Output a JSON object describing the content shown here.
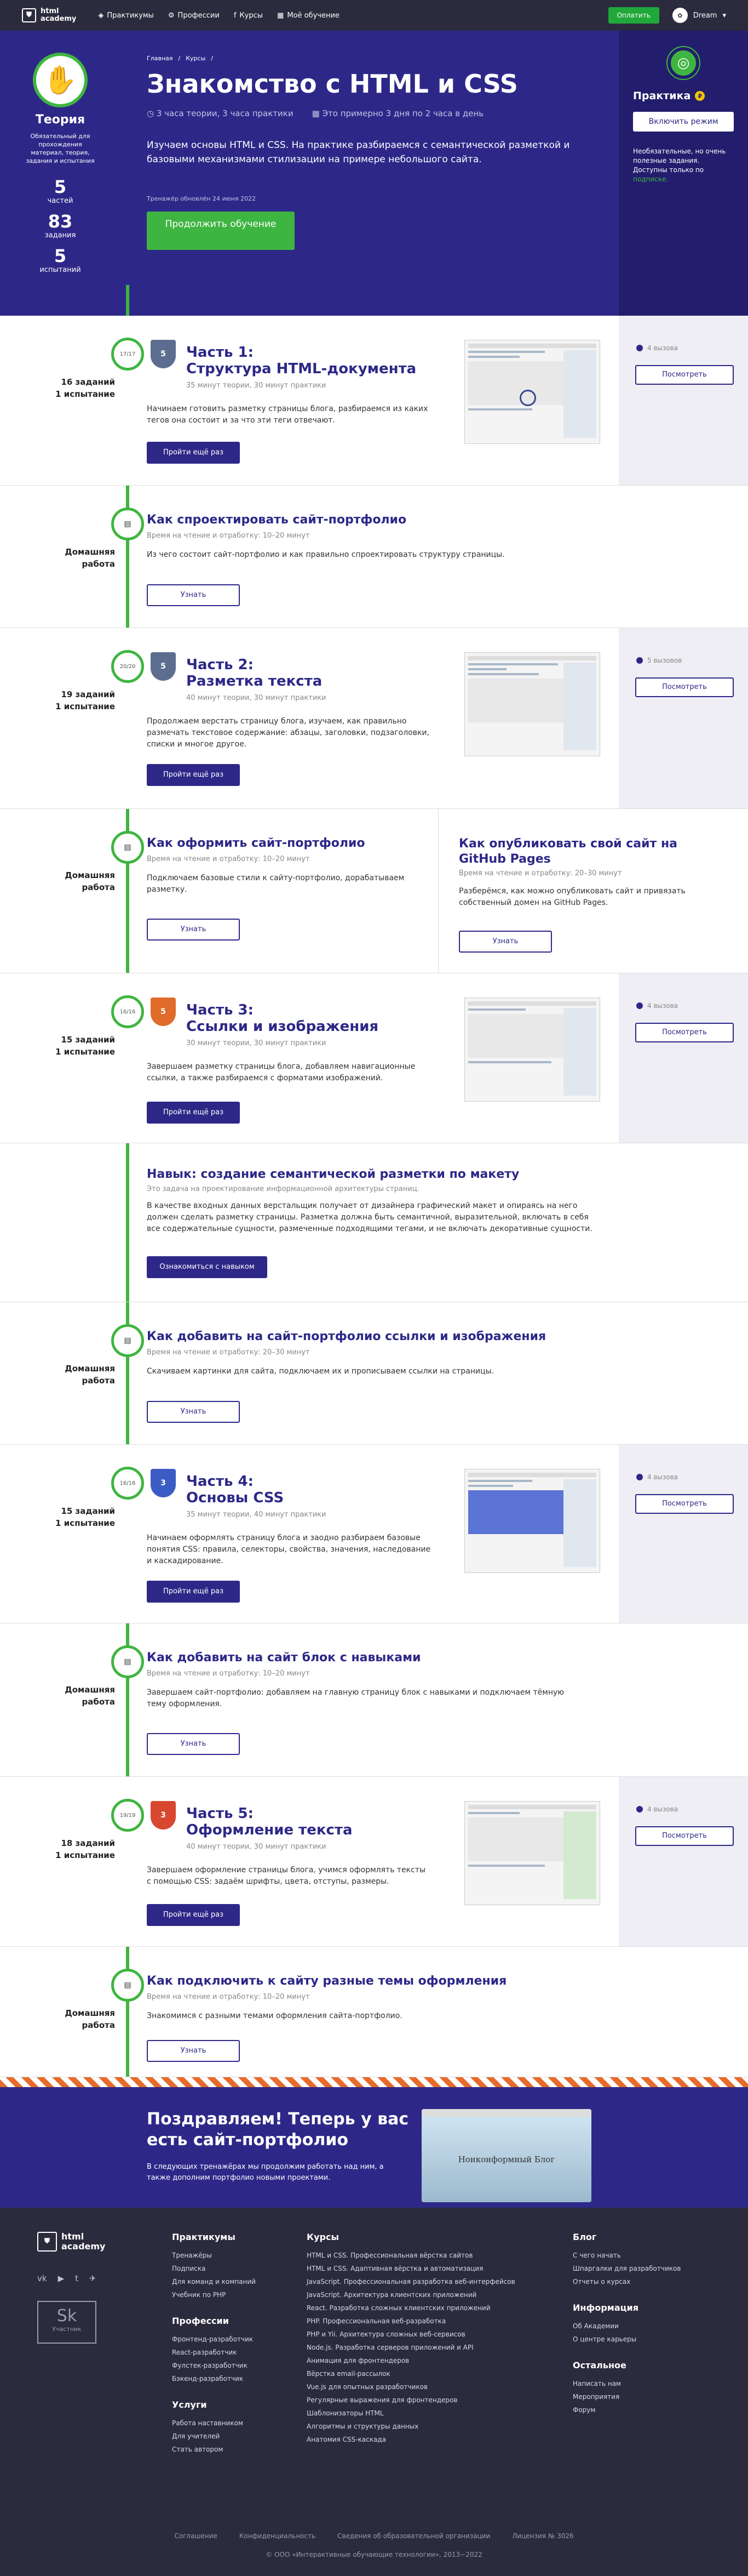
{
  "header": {
    "logo_line1": "html",
    "logo_line2": "academy",
    "nav": [
      {
        "icon": "◈",
        "label": "Практикумы"
      },
      {
        "icon": "⚙",
        "label": "Профессии"
      },
      {
        "icon": "f",
        "label": "Курсы"
      },
      {
        "icon": "▦",
        "label": "Моё обучение"
      }
    ],
    "pay": "Оплатить",
    "user": "Dream"
  },
  "hero": {
    "breadcrumb": [
      "Главная",
      "Курсы"
    ],
    "title": "Знакомство с HTML и CSS",
    "meta1": "3 часа теории, 3 часа практики",
    "meta2": "Это примерно 3 дня по 2 часа в день",
    "desc": "Изучаем основы HTML и CSS. На практике разбираемся с семантической разметкой и базовыми механизмами стилизации на примере небольшого сайта.",
    "updated": "Тренажёр обновлён 24 июня 2022",
    "cta": "Продолжить обучение"
  },
  "theory": {
    "title": "Теория",
    "desc": "Обязательный для прохождения материал, теория, задания и испытания",
    "parts_num": "5",
    "parts_lbl": "частей",
    "tasks_num": "83",
    "tasks_lbl": "задания",
    "tests_num": "5",
    "tests_lbl": "испытаний"
  },
  "practice": {
    "title": "Практика",
    "btn": "Включить режим",
    "note": "Необязательные, но очень полезные задания. Доступны только по",
    "link": "подписке."
  },
  "parts": [
    {
      "title": "Часть 1:",
      "subtitle": "Структура HTML-документа",
      "meta": "35 минут теории, 30 минут практики",
      "desc": "Начинаем готовить разметку страницы блога, разбираемся из каких тегов она состоит и за что эти теги отвечают.",
      "btn": "Пройти ещё раз",
      "calls": "4 вызова",
      "side_btn": "Посмотреть",
      "node": "17/17",
      "cap1": "16 заданий",
      "cap2": "1 испытание"
    },
    {
      "title": "Часть 2:",
      "subtitle": "Разметка текста",
      "meta": "40 минут теории, 30 минут практики",
      "desc": "Продолжаем верстать страницу блога, изучаем, как правильно размечать текстовое содержание: абзацы, заголовки, подзаголовки, списки и многое другое.",
      "btn": "Пройти ещё раз",
      "calls": "5 вызовов",
      "side_btn": "Посмотреть",
      "node": "20/20",
      "cap1": "19 заданий",
      "cap2": "1 испытание"
    },
    {
      "title": "Часть 3:",
      "subtitle": "Ссылки и изображения",
      "meta": "30 минут теории, 30 минут практики",
      "desc": "Завершаем разметку страницы блога, добавляем навигационные ссылки, а также разбираемся с форматами изображений.",
      "btn": "Пройти ещё раз",
      "calls": "4 вызова",
      "side_btn": "Посмотреть",
      "node": "16/16",
      "cap1": "15 заданий",
      "cap2": "1 испытание"
    },
    {
      "title": "Часть 4:",
      "subtitle": "Основы CSS",
      "meta": "35 минут теории, 40 минут практики",
      "desc": "Начинаем оформлять страницу блога и заодно разбираем базовые понятия CSS: правила, селекторы, свойства, значения, наследование и каскадирование.",
      "btn": "Пройти ещё раз",
      "calls": "4 вызова",
      "side_btn": "Посмотреть",
      "node": "16/16",
      "cap1": "15 заданий",
      "cap2": "1 испытание"
    },
    {
      "title": "Часть 5:",
      "subtitle": "Оформление текста",
      "meta": "40 минут теории, 30 минут практики",
      "desc": "Завершаем оформление страницы блога, учимся оформлять тексты с помощью CSS: задаём шрифты, цвета, отступы, размеры.",
      "btn": "Пройти ещё раз",
      "calls": "4 вызова",
      "side_btn": "Посмотреть",
      "node": "19/19",
      "cap1": "18 заданий",
      "cap2": "1 испытание"
    }
  ],
  "home": {
    "cap1": "Домашняя",
    "cap2": "работа",
    "node": "▤"
  },
  "homeworks": [
    {
      "title": "Как спроектировать сайт-портфолио",
      "meta": "Время на чтение и отработку: 10–20 минут",
      "desc": "Из чего состоит сайт-портфолио и как правильно спроектировать структуру страницы.",
      "btn": "Узнать"
    },
    {
      "title": "Как оформить сайт-портфолио",
      "meta": "Время на чтение и отработку: 10–20 минут",
      "desc": "Подключаем базовые стили к сайту-портфолио, дорабатываем разметку.",
      "btn": "Узнать",
      "title2": "Как опубликовать свой сайт на GitHub Pages",
      "meta2": "Время на чтение и отработку: 20–30 минут",
      "desc2": "Разберёмся, как можно опубликовать сайт и привязать собственный домен на GitHub Pages.",
      "btn2": "Узнать"
    },
    {
      "title": "Как добавить на сайт-портфолио ссылки и изображения",
      "meta": "Время на чтение и отработку: 20–30 минут",
      "desc": "Скачиваем картинки для сайта, подключаем их и прописываем ссылки на страницы.",
      "btn": "Узнать"
    },
    {
      "title": "Как добавить на сайт блок с навыками",
      "meta": "Время на чтение и отработку: 10–20 минут",
      "desc": "Завершаем сайт-портфолио: добавляем на главную страницу блок с навыками и подключаем тёмную тему оформления.",
      "btn": "Узнать"
    },
    {
      "title": "Как подключить к сайту разные темы оформления",
      "meta": "Время на чтение и отработку: 10–20 минут",
      "desc": "Знакомимся с разными темами оформления сайта-портфолио.",
      "btn": "Узнать"
    }
  ],
  "skill": {
    "title": "Навык: создание семантической разметки по макету",
    "meta": "Это задача на проектирование информационной архитектуры страниц.",
    "desc": "В качестве входных данных верстальщик получает от дизайнера графический макет и опираясь на него должен сделать разметку страницы. Разметка должна быть семантичной, выразительной, включать в себя все содержательные сущности, размеченные подходящими тегами, и не включать декоративные сущности.",
    "btn": "Ознакомиться с навыком"
  },
  "congrats": {
    "title": "Поздравляем! Теперь у вас есть сайт-портфолио",
    "desc": "В следующих тренажёрах мы продолжим работать над ним, а также дополним портфолио новыми проектами.",
    "shot": "Нонконформный Блог"
  },
  "footer": {
    "logo1": "html",
    "logo2": "academy",
    "socials": [
      "vk",
      "▶",
      "t",
      "✈"
    ],
    "sk": "Sk",
    "sk_lbl": "Участник",
    "col1": {
      "h": "Практикумы",
      "items": [
        "Тренажёры",
        "Подписка",
        "Для команд и компаний",
        "Учебник по PHP"
      ]
    },
    "col1b": {
      "h": "Профессии",
      "items": [
        "Фронтенд-разработчик",
        "React-разработчик",
        "Фулстек-разработчик",
        "Бэкенд-разработчик"
      ]
    },
    "col1c": {
      "h": "Услуги",
      "items": [
        "Работа наставником",
        "Для учителей",
        "Стать автором"
      ]
    },
    "col2": {
      "h": "Курсы",
      "items": [
        "HTML и CSS. Профессиональная вёрстка сайтов",
        "HTML и CSS. Адаптивная вёрстка и автоматизация",
        "JavaScript. Профессиональная разработка веб-интерфейсов",
        "JavaScript. Архитектура клиентских приложений",
        "React. Разработка сложных клиентских приложений",
        "PHP. Профессиональная веб-разработка",
        "PHP и Yii. Архитектура сложных веб-сервисов",
        "Node.js. Разработка серверов приложений и API",
        "Анимация для фронтендеров",
        "Вёрстка email-рассылок",
        "Vue.js для опытных разработчиков",
        "Регулярные выражения для фронтендеров",
        "Шаблонизаторы HTML",
        "Алгоритмы и структуры данных",
        "Анатомия CSS-каскада"
      ]
    },
    "col3": {
      "h": "Блог",
      "items": [
        "С чего начать",
        "Шпаргалки для разработчиков",
        "Отчеты о курсах"
      ]
    },
    "col3b": {
      "h": "Информация",
      "items": [
        "Об Академии",
        "О центре карьеры"
      ]
    },
    "col3c": {
      "h": "Остальное",
      "items": [
        "Написать нам",
        "Мероприятия",
        "Форум"
      ]
    },
    "bottom": [
      "Соглашение",
      "Конфиденциальность",
      "Сведения об образовательной организации",
      "Лицензия № 3026"
    ],
    "copyright": "© ООО «Интерактивные обучающие технологии», 2013−2022"
  }
}
